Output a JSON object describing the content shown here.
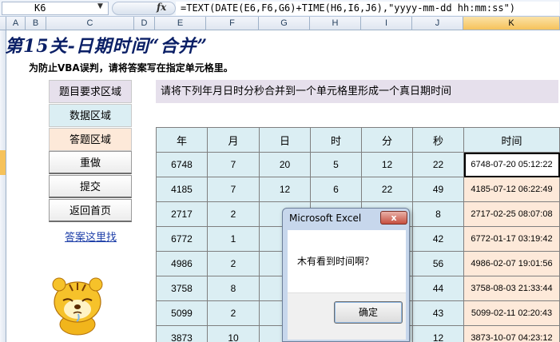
{
  "formula_bar": {
    "cell_ref": "K6",
    "fx_label": "fx",
    "formula": "=TEXT(DATE(E6,F6,G6)+TIME(H6,I6,J6),\"yyyy-mm-dd hh:mm:ss\")"
  },
  "columns": [
    "A",
    "B",
    "C",
    "D",
    "E",
    "F",
    "G",
    "H",
    "I",
    "J",
    "K"
  ],
  "header": {
    "title": "第15关-日期时间“合并”",
    "subtitle": "为防止VBA误判，请将答案写在指定单元格里。"
  },
  "left_panel": {
    "req_area": "题目要求区域",
    "data_area": "数据区域",
    "answer_area": "答题区域",
    "redo": "重做",
    "submit": "提交",
    "home": "返回首页",
    "answer_link": "答案这里找"
  },
  "instruction": "请将下列年月日时分秒合并到一个单元格里形成一个真日期时间",
  "table": {
    "headers": [
      "年",
      "月",
      "日",
      "时",
      "分",
      "秒",
      "时间"
    ],
    "rows": [
      [
        "6748",
        "7",
        "20",
        "5",
        "12",
        "22",
        "6748-07-20 05:12:22"
      ],
      [
        "4185",
        "7",
        "12",
        "6",
        "22",
        "49",
        "4185-07-12 06:22:49"
      ],
      [
        "2717",
        "2",
        "",
        "",
        "",
        "8",
        "2717-02-25 08:07:08"
      ],
      [
        "6772",
        "1",
        "",
        "",
        "",
        "42",
        "6772-01-17 03:19:42"
      ],
      [
        "4986",
        "2",
        "",
        "",
        "",
        "56",
        "4986-02-07 19:01:56"
      ],
      [
        "3758",
        "8",
        "",
        "",
        "",
        "44",
        "3758-08-03 21:33:44"
      ],
      [
        "5099",
        "2",
        "",
        "",
        "",
        "43",
        "5099-02-11 02:20:43"
      ],
      [
        "3873",
        "10",
        "",
        "",
        "",
        "12",
        "3873-10-07 04:23:12"
      ]
    ]
  },
  "dialog": {
    "title": "Microsoft Excel",
    "close": "x",
    "message": "木有看到时间啊？",
    "ok": "确定"
  },
  "colors": {
    "data_bg": "#dbeef3",
    "answer_bg": "#fde9d9",
    "request_bg": "#e6e0ec",
    "title_color": "#0a1f66"
  }
}
